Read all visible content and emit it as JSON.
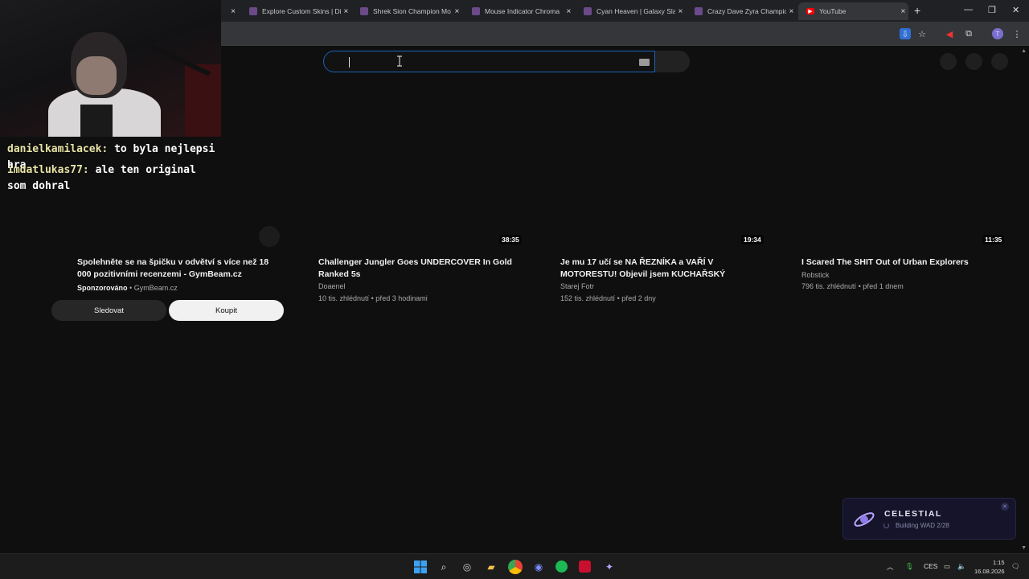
{
  "browser": {
    "tabs": [
      {
        "title": "Explore Custom Skins | Di",
        "active": false
      },
      {
        "title": "Shrek Sion Champion Mo",
        "active": false
      },
      {
        "title": "Mouse Indicator Chroma",
        "active": false
      },
      {
        "title": "Cyan Heaven | Galaxy Slay",
        "active": false
      },
      {
        "title": "Crazy Dave Zyra Champio",
        "active": false
      },
      {
        "title": "YouTube",
        "active": true
      }
    ],
    "new_tab": "+",
    "close_glyph": "×"
  },
  "stream_chat": [
    {
      "user": "danielkamilacek:",
      "message": "to byla nejlepsi hra"
    },
    {
      "user": "imdatlukas77:",
      "message": "ale ten original som dohral"
    }
  ],
  "videos": [
    {
      "kind": "ad",
      "title": "Spolehněte se na špičku v odvětví s více než 18 000 pozitivními recenzemi - GymBeam.cz",
      "sponsored": "Sponzorováno",
      "advertiser": "GymBeam.cz",
      "follow_label": "Sledovat",
      "buy_label": "Koupit"
    },
    {
      "kind": "video",
      "duration": "38:35",
      "title": "Challenger Jungler Goes UNDERCOVER In Gold Ranked 5s",
      "channel": "Doaenel",
      "views": "10 tis. zhlédnutí",
      "age": "před 3 hodinami"
    },
    {
      "kind": "video",
      "duration": "19:34",
      "title": "Je mu 17 učí se NA ŘEZNÍKA a VAŘÍ V MOTORESTU!  Objevil jsem KUCHAŘSKÝ TALEN…",
      "channel": "Starej Fotr",
      "views": "152 tis. zhlédnutí",
      "age": "před 2 dny"
    },
    {
      "kind": "video",
      "duration": "11:35",
      "title": "I Scared The SHIT Out of Urban Explorers",
      "channel": "Robstick",
      "views": "796 tis. zhlédnutí",
      "age": "před 1 dnem"
    }
  ],
  "meta_separator": "•",
  "notification": {
    "app": "CELESTIAL",
    "status": "Building WAD 2/28"
  },
  "taskbar": {
    "language": "CES",
    "time": "1:15",
    "date": "16.08.2026"
  },
  "colors": {
    "background": "#0f0f0f",
    "search_focus": "#1c62b9",
    "chat_user": "#e8e3a6"
  }
}
